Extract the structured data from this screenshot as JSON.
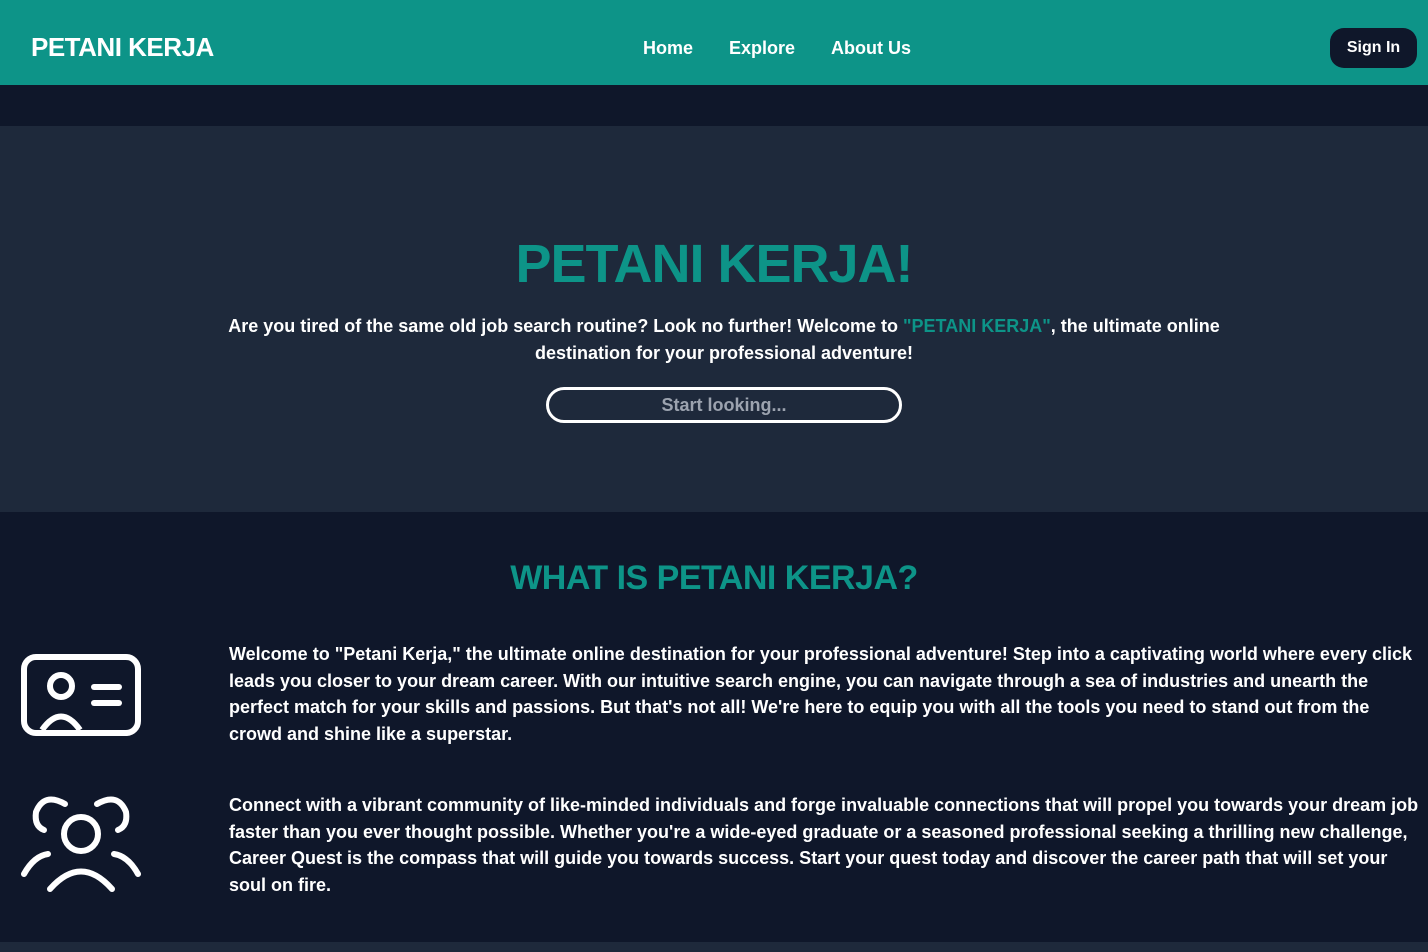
{
  "navbar": {
    "brand": "PETANI KERJA",
    "links": [
      "Home",
      "Explore",
      "About Us"
    ],
    "signin_label": "Sign In",
    "color": "#0d9488"
  },
  "hero": {
    "title": "PETANI KERJA!",
    "text_before": "Are you tired of the same old job search routine? Look no further! Welcome to ",
    "text_accent": "\"PETANI KERJA\"",
    "text_after": ", the ultimate online destination for your professional adventure!",
    "search_placeholder": "Start looking...",
    "background": "#1e293b"
  },
  "about": {
    "title": "WHAT IS PETANI KERJA?",
    "features": [
      {
        "icon": "id-card-icon",
        "text": "Welcome to \"Petani Kerja,\" the ultimate online destination for your professional adventure! Step into a captivating world where every click leads you closer to your dream career. With our intuitive search engine, you can navigate through a sea of industries and unearth the perfect match for your skills and passions. But that's not all! We're here to equip you with all the tools you need to stand out from the crowd and shine like a superstar."
      },
      {
        "icon": "users-icon",
        "text": "Connect with a vibrant community of like-minded individuals and forge invaluable connections that will propel you towards your dream job faster than you ever thought possible. Whether you're a wide-eyed graduate or a seasoned professional seeking a thrilling new challenge, Career Quest is the compass that will guide you towards success. Start your quest today and discover the career path that will set your soul on fire."
      }
    ],
    "background": "#0f172a"
  }
}
